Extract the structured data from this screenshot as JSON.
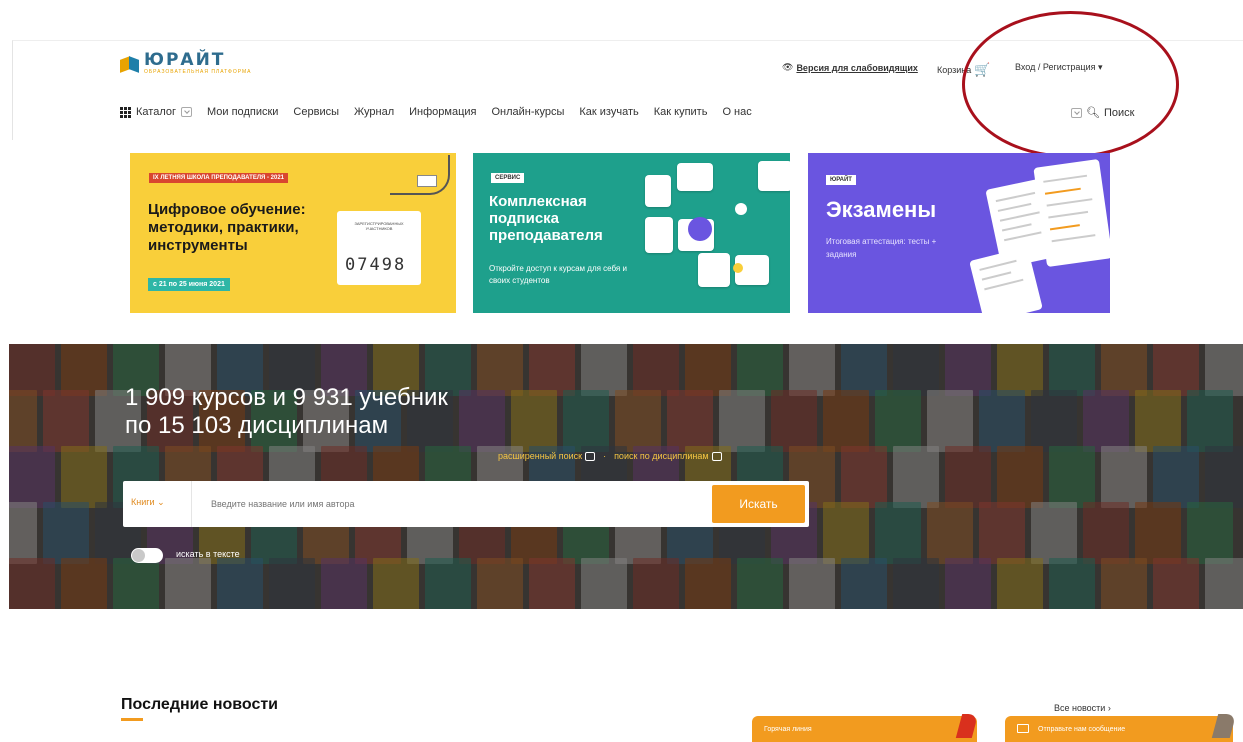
{
  "header": {
    "logo": {
      "name": "ЮРАЙТ",
      "sub": "ОБРАЗОВАТЕЛЬНАЯ ПЛАТФОРМА"
    },
    "low_vision": "Версия для слабовидящих",
    "cart": "Корзина",
    "login": "Вход / Регистрация ▾",
    "search": "Поиск"
  },
  "nav": {
    "items": [
      "Каталог",
      "Мои подписки",
      "Сервисы",
      "Журнал",
      "Информация",
      "Онлайн-курсы",
      "Как изучать",
      "Как купить",
      "О нас"
    ]
  },
  "banners": [
    {
      "badge": "IX ЛЕТНЯЯ ШКОЛА ПРЕПОДАВАТЕЛЯ - 2021",
      "title": "Цифровое обучение: методики, практики, инструменты",
      "dates": "с 21 по 25 июня 2021",
      "counter_label": "ЗАРЕГИСТРИРОВАННЫХ УЧАСТНИКОВ",
      "counter": "07498"
    },
    {
      "badge": "СЕРВИС",
      "title": "Комплексная подписка преподавателя",
      "subtitle": "Откройте доступ к курсам для себя и своих студентов"
    },
    {
      "badge": "ЮРАЙТ",
      "title": "Экзамены",
      "subtitle": "Итоговая аттестация: тесты + задания"
    }
  ],
  "hero": {
    "title_line1": "1 909 курсов и 9 931 учебник",
    "title_line2": "по 15 103 дисциплинам",
    "advanced_search": "расширенный поиск",
    "discipline_search": "поиск по дисциплинам",
    "search_type": "Книги",
    "search_placeholder": "Введите название или имя автора",
    "search_button": "Искать",
    "toggle_label": "искать в тексте"
  },
  "news": {
    "title": "Последние новости",
    "all_news": "Все новости  ›"
  },
  "widgets": {
    "hotline": "Горячая линия",
    "feedback": "Отправьте нам сообщение"
  },
  "colors": {
    "accent_orange": "#f29b1f",
    "banner_yellow": "#f9cf3a",
    "banner_teal": "#1ea08c",
    "banner_purple": "#6a55e0",
    "annotation_red": "#a8101c"
  }
}
